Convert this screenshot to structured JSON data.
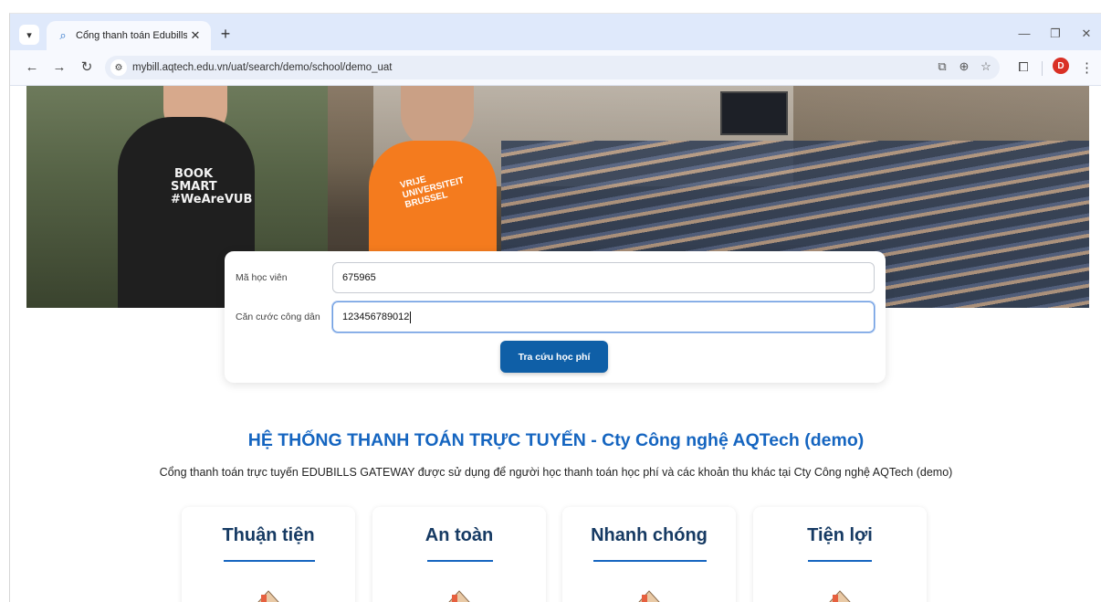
{
  "browser": {
    "tab_title": "Cổng thanh toán Edubills",
    "tab_favicon": "qr-search-icon",
    "url": "mybill.aqtech.edu.vn/uat/search/demo/school/demo_uat",
    "profile_initial": "D"
  },
  "hero": {
    "shirt_badge": "BOOK SMART #WeAreVUB",
    "shirt_text": "VRIJE UNIVERSITEIT BRUSSEL"
  },
  "search": {
    "student_id_label": "Mã học viên",
    "student_id_value": "675965",
    "citizen_id_label": "Căn cước công dân",
    "citizen_id_value": "123456789012",
    "submit_label": "Tra cứu học phí"
  },
  "intro": {
    "title": "HỆ THỐNG THANH TOÁN TRỰC TUYẾN - Cty Công nghệ AQTech (demo)",
    "description": "Cổng thanh toán trực tuyến EDUBILLS GATEWAY được sử dụng để người học thanh toán học phí và các khoản thu khác tại Cty Công nghệ AQTech (demo)"
  },
  "features": [
    {
      "title": "Thuận tiện"
    },
    {
      "title": "An toàn"
    },
    {
      "title": "Nhanh chóng"
    },
    {
      "title": "Tiện lợi"
    }
  ],
  "colors": {
    "primary": "#0f5fa7",
    "heading": "#1565c0",
    "feature_title": "#163a63",
    "profile": "#d93025"
  }
}
